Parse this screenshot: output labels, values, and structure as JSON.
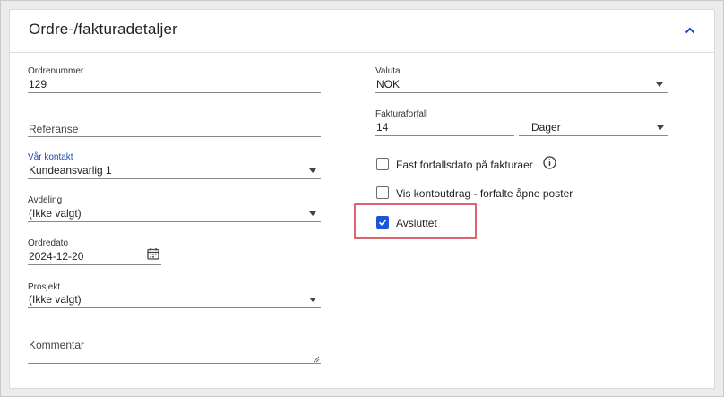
{
  "header": {
    "title": "Ordre-/fakturadetaljer"
  },
  "left": {
    "ordrenummer": {
      "label": "Ordrenummer",
      "value": "129"
    },
    "referanse": {
      "placeholder": "Referanse"
    },
    "var_kontakt": {
      "label": "Vår kontakt",
      "value": "Kundeansvarlig 1"
    },
    "avdeling": {
      "label": "Avdeling",
      "value": "(Ikke valgt)"
    },
    "ordredato": {
      "label": "Ordredato",
      "value": "2024-12-20"
    },
    "prosjekt": {
      "label": "Prosjekt",
      "value": "(Ikke valgt)"
    },
    "kommentar": {
      "placeholder": "Kommentar"
    }
  },
  "right": {
    "valuta": {
      "label": "Valuta",
      "value": "NOK"
    },
    "fakturaforfall": {
      "label": "Fakturaforfall",
      "value": "14"
    },
    "unit": {
      "value": "Dager"
    },
    "checkboxes": [
      {
        "label": "Fast forfallsdato på fakturaer",
        "checked": false
      },
      {
        "label": "Vis kontoutdrag - forfalte åpne poster",
        "checked": false
      },
      {
        "label": "Avsluttet",
        "checked": true
      }
    ]
  },
  "colors": {
    "accent": "#1a56db",
    "highlight": "#d9646c"
  },
  "icons": [
    "chevron-up-icon",
    "calendar-icon",
    "info-icon",
    "checkmark-icon",
    "resize-handle-icon"
  ]
}
